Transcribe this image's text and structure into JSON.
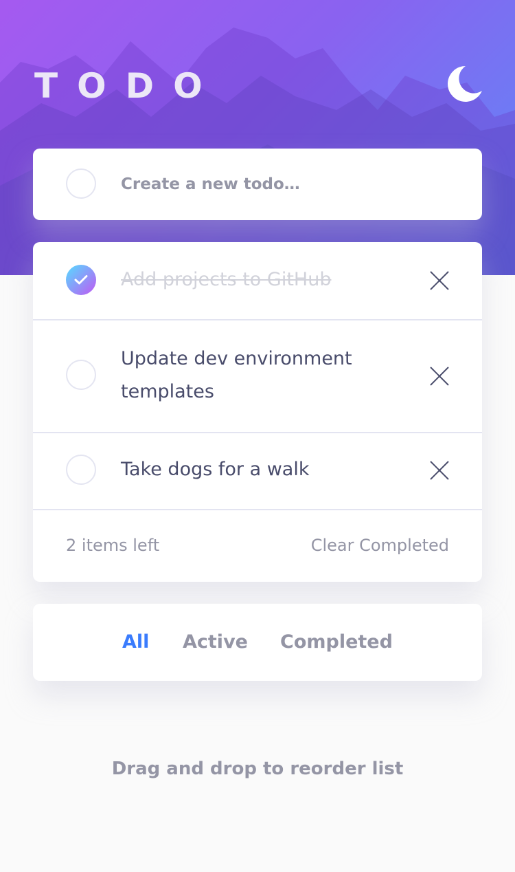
{
  "header": {
    "title": "TODO",
    "theme_toggle_icon": "moon-icon"
  },
  "new_todo": {
    "placeholder": "Create a new todo…"
  },
  "todos": [
    {
      "text": "Add projects to GitHub",
      "completed": true
    },
    {
      "text": "Update dev environment templates",
      "completed": false
    },
    {
      "text": "Take dogs for a walk",
      "completed": false
    }
  ],
  "footer": {
    "items_left": "2 items left",
    "clear_completed": "Clear Completed"
  },
  "filters": {
    "all": "All",
    "active": "Active",
    "completed": "Completed",
    "selected": "All"
  },
  "hint": "Drag and drop to reorder list",
  "colors": {
    "accent": "#3a7cfd",
    "check_gradient_start": "#55ddff",
    "check_gradient_end": "#c058f3",
    "text_primary": "#494c6b",
    "text_muted": "#9495a5",
    "completed_text": "#d1d2da"
  }
}
